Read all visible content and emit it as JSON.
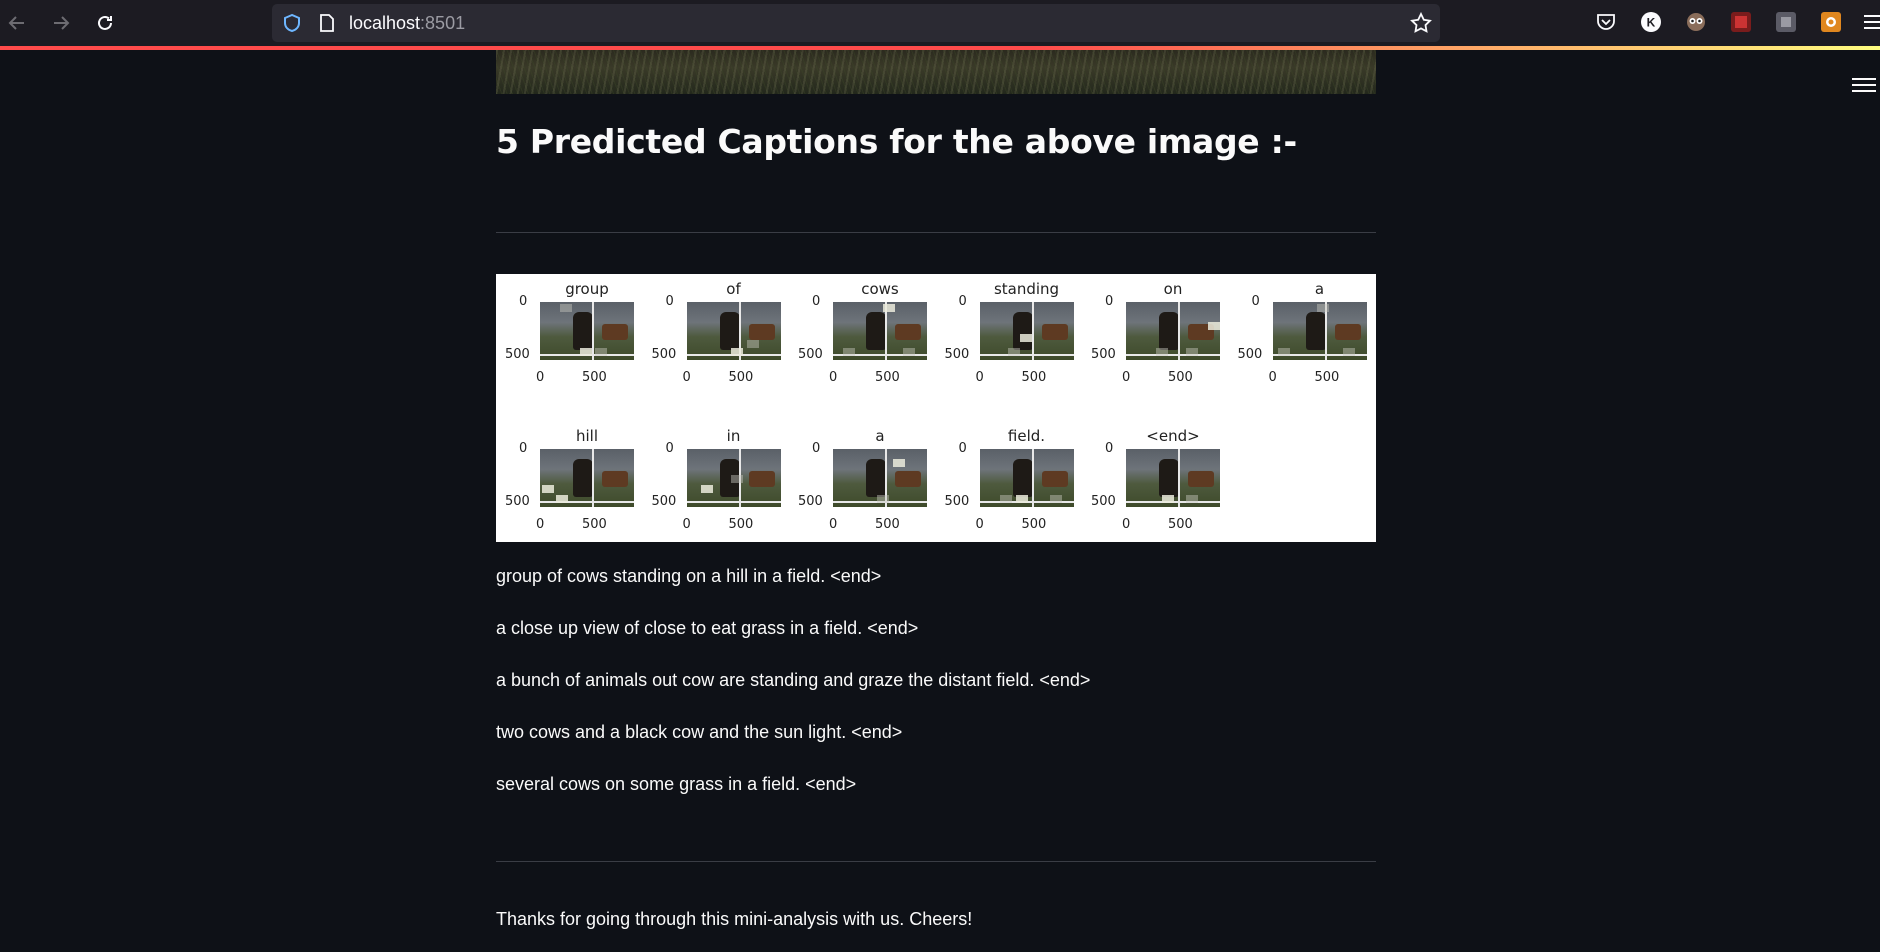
{
  "browser": {
    "url_host": "localhost",
    "url_port": ":8501"
  },
  "page": {
    "title": "5 Predicted Captions for the above image :-",
    "closing": "Thanks for going through this mini-analysis with us. Cheers!"
  },
  "attention_figure": {
    "y_tick_top": "0",
    "y_tick_bottom": "500",
    "x_tick_left": "0",
    "x_tick_right": "500",
    "words": [
      "group",
      "of",
      "cows",
      "standing",
      "on",
      "a",
      "hill",
      "in",
      "a",
      "field.",
      "<end>"
    ]
  },
  "captions": [
    "group of cows standing on a hill in a field. <end>",
    "a close up view of close to eat grass in a field. <end>",
    "a bunch of animals out cow are standing and graze the distant field. <end>",
    "two cows and a black cow and the sun light. <end>",
    "several cows on some grass in a field. <end>"
  ],
  "toolbar_icons": [
    "pocket-icon",
    "account-k-icon",
    "extension-owl-icon",
    "extension-core-icon",
    "extension-square-icon",
    "extension-orange-icon"
  ]
}
